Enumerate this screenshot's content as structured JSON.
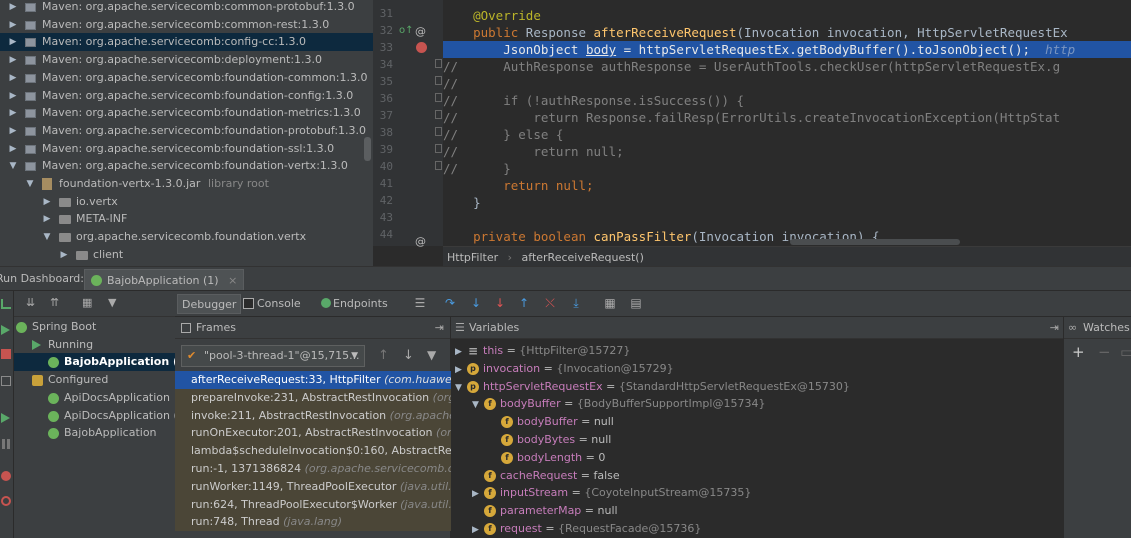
{
  "project_tree": {
    "items": [
      {
        "label": "Maven: org.apache.servicecomb:common-protobuf:1.3.0",
        "depth": 0,
        "expanded": false,
        "selected": false,
        "kind": "lib"
      },
      {
        "label": "Maven: org.apache.servicecomb:common-rest:1.3.0",
        "depth": 0,
        "expanded": false,
        "selected": false,
        "kind": "lib"
      },
      {
        "label": "Maven: org.apache.servicecomb:config-cc:1.3.0",
        "depth": 0,
        "expanded": false,
        "selected": true,
        "kind": "lib"
      },
      {
        "label": "Maven: org.apache.servicecomb:deployment:1.3.0",
        "depth": 0,
        "expanded": false,
        "selected": false,
        "kind": "lib"
      },
      {
        "label": "Maven: org.apache.servicecomb:foundation-common:1.3.0",
        "depth": 0,
        "expanded": false,
        "selected": false,
        "kind": "lib"
      },
      {
        "label": "Maven: org.apache.servicecomb:foundation-config:1.3.0",
        "depth": 0,
        "expanded": false,
        "selected": false,
        "kind": "lib"
      },
      {
        "label": "Maven: org.apache.servicecomb:foundation-metrics:1.3.0",
        "depth": 0,
        "expanded": false,
        "selected": false,
        "kind": "lib"
      },
      {
        "label": "Maven: org.apache.servicecomb:foundation-protobuf:1.3.0",
        "depth": 0,
        "expanded": false,
        "selected": false,
        "kind": "lib"
      },
      {
        "label": "Maven: org.apache.servicecomb:foundation-ssl:1.3.0",
        "depth": 0,
        "expanded": false,
        "selected": false,
        "kind": "lib"
      },
      {
        "label": "Maven: org.apache.servicecomb:foundation-vertx:1.3.0",
        "depth": 0,
        "expanded": true,
        "selected": false,
        "kind": "lib"
      },
      {
        "label": "foundation-vertx-1.3.0.jar",
        "suffix": "library root",
        "depth": 1,
        "expanded": true,
        "selected": false,
        "kind": "jar"
      },
      {
        "label": "io.vertx",
        "depth": 2,
        "expanded": false,
        "selected": false,
        "kind": "pkg"
      },
      {
        "label": "META-INF",
        "depth": 2,
        "expanded": false,
        "selected": false,
        "kind": "pkg"
      },
      {
        "label": "org.apache.servicecomb.foundation.vertx",
        "depth": 2,
        "expanded": true,
        "selected": false,
        "kind": "pkg"
      },
      {
        "label": "client",
        "depth": 3,
        "expanded": false,
        "selected": false,
        "kind": "pkg"
      }
    ]
  },
  "editor": {
    "lines": [
      {
        "n": "31",
        "hl": false,
        "segs": [
          [
            "    ",
            ""
          ],
          [
            "@Override",
            "an"
          ]
        ]
      },
      {
        "n": "32",
        "hl": false,
        "segs": [
          [
            "    ",
            ""
          ],
          [
            "public ",
            "kw"
          ],
          [
            "Response ",
            ""
          ],
          [
            "afterReceiveRequest",
            "fn"
          ],
          [
            "(Invocation invocation, HttpServletRequestEx",
            ""
          ]
        ]
      },
      {
        "n": "33",
        "hl": true,
        "segs": [
          [
            "        JsonObject ",
            ""
          ],
          [
            "body",
            "ul"
          ],
          [
            " = httpServletRequestEx.getBodyBuffer().toJsonObject();  ",
            ""
          ],
          [
            "http",
            "it"
          ]
        ]
      },
      {
        "n": "34",
        "hl": false,
        "segs": [
          [
            "//",
            "cm"
          ],
          [
            "      AuthResponse authResponse = UserAuthTools.checkUser(httpServletRequestEx.g",
            "cm"
          ]
        ]
      },
      {
        "n": "35",
        "hl": false,
        "segs": [
          [
            "//",
            "cm"
          ]
        ]
      },
      {
        "n": "36",
        "hl": false,
        "segs": [
          [
            "//",
            "cm"
          ],
          [
            "      if (!authResponse.isSuccess()) {",
            "cm"
          ]
        ]
      },
      {
        "n": "37",
        "hl": false,
        "segs": [
          [
            "//",
            "cm"
          ],
          [
            "          return Response.failResp(ErrorUtils.createInvocationException(HttpStat",
            "cm"
          ]
        ]
      },
      {
        "n": "38",
        "hl": false,
        "segs": [
          [
            "//",
            "cm"
          ],
          [
            "      } else {",
            "cm"
          ]
        ]
      },
      {
        "n": "39",
        "hl": false,
        "segs": [
          [
            "//",
            "cm"
          ],
          [
            "          return null;",
            "cm"
          ]
        ]
      },
      {
        "n": "40",
        "hl": false,
        "segs": [
          [
            "//",
            "cm"
          ],
          [
            "      }",
            "cm"
          ]
        ]
      },
      {
        "n": "41",
        "hl": false,
        "segs": [
          [
            "        ",
            ""
          ],
          [
            "return null",
            "kw"
          ],
          [
            ";",
            "kw"
          ]
        ]
      },
      {
        "n": "42",
        "hl": false,
        "segs": [
          [
            "    }",
            ""
          ]
        ]
      },
      {
        "n": "43",
        "hl": false,
        "segs": [
          [
            "",
            ""
          ]
        ]
      },
      {
        "n": "44",
        "hl": false,
        "segs": [
          [
            "    ",
            ""
          ],
          [
            "private boolean ",
            "kw"
          ],
          [
            "canPassFilter",
            "fn"
          ],
          [
            "(Invocation invocation) {",
            ""
          ]
        ]
      }
    ]
  },
  "breadcrumb": {
    "class_name": "HttpFilter",
    "separator": "›",
    "method_name": "afterReceiveRequest()"
  },
  "run_dashboard": {
    "title": "Run Dashboard:",
    "tab_label": "BajobApplication (1)",
    "close": "×"
  },
  "run_tree": {
    "items": [
      {
        "label": "Spring Boot",
        "depth": 0,
        "selected": false
      },
      {
        "label": "Running",
        "depth": 1,
        "selected": false
      },
      {
        "label": "BajobApplication (1)",
        "depth": 2,
        "selected": true
      },
      {
        "label": "Configured",
        "depth": 1,
        "selected": false
      },
      {
        "label": "ApiDocsApplication",
        "depth": 2,
        "selected": false
      },
      {
        "label": "ApiDocsApplication (",
        "depth": 2,
        "selected": false
      },
      {
        "label": "BajobApplication",
        "depth": 2,
        "selected": false
      }
    ]
  },
  "debugger_tabs": {
    "debugger": "Debugger",
    "console": "Console",
    "endpoints": "Endpoints"
  },
  "frames": {
    "title": "Frames",
    "thread": "\"pool-3-thread-1\"@15,715...",
    "items": [
      {
        "method": "afterReceiveRequest:33, HttpFilter",
        "loc": "(com.huawei.cloud",
        "selected": true
      },
      {
        "method": "prepareInvoke:231, AbstractRestInvocation",
        "loc": "(org.apa",
        "selected": false
      },
      {
        "method": "invoke:211, AbstractRestInvocation",
        "loc": "(org.apache.serv",
        "selected": false
      },
      {
        "method": "runOnExecutor:201, AbstractRestInvocation",
        "loc": "(org.apa",
        "selected": false
      },
      {
        "method": "lambda$scheduleInvocation$0:160, AbstractRestInvoca",
        "loc": "",
        "selected": false
      },
      {
        "method": "run:-1, 1371386824",
        "loc": "(org.apache.servicecomb.commo",
        "selected": false
      },
      {
        "method": "runWorker:1149, ThreadPoolExecutor",
        "loc": "(java.util.conc",
        "selected": false
      },
      {
        "method": "run:624, ThreadPoolExecutor$Worker",
        "loc": "(java.util.conc",
        "selected": false
      },
      {
        "method": "run:748, Thread",
        "loc": "(java.lang)",
        "selected": false
      }
    ]
  },
  "variables": {
    "title": "Variables",
    "items": [
      {
        "depth": 0,
        "toggle": "▶",
        "icon": "this",
        "name": "this",
        "value": "{HttpFilter@15727}",
        "is_ref": true
      },
      {
        "depth": 0,
        "toggle": "▶",
        "icon": "p",
        "name": "invocation",
        "value": "{Invocation@15729}",
        "is_ref": true
      },
      {
        "depth": 0,
        "toggle": "▼",
        "icon": "p",
        "name": "httpServletRequestEx",
        "value": "{StandardHttpServletRequestEx@15730}",
        "is_ref": true
      },
      {
        "depth": 1,
        "toggle": "▼",
        "icon": "f",
        "name": "bodyBuffer",
        "value": "{BodyBufferSupportImpl@15734}",
        "is_ref": true
      },
      {
        "depth": 2,
        "toggle": "",
        "icon": "f",
        "name": "bodyBuffer",
        "value": "null",
        "is_ref": false
      },
      {
        "depth": 2,
        "toggle": "",
        "icon": "f",
        "name": "bodyBytes",
        "value": "null",
        "is_ref": false
      },
      {
        "depth": 2,
        "toggle": "",
        "icon": "f",
        "name": "bodyLength",
        "value": "0",
        "is_ref": false
      },
      {
        "depth": 1,
        "toggle": "",
        "icon": "f",
        "name": "cacheRequest",
        "value": "false",
        "is_ref": false
      },
      {
        "depth": 1,
        "toggle": "▶",
        "icon": "f",
        "name": "inputStream",
        "value": "{CoyoteInputStream@15735}",
        "is_ref": true
      },
      {
        "depth": 1,
        "toggle": "",
        "icon": "f",
        "name": "parameterMap",
        "value": "null",
        "is_ref": false
      },
      {
        "depth": 1,
        "toggle": "▶",
        "icon": "f",
        "name": "request",
        "value": "{RequestFacade@15736}",
        "is_ref": true
      }
    ]
  },
  "watches": {
    "title": "Watches",
    "add": "+",
    "remove": "−"
  },
  "colors": {
    "selection_blue": "#2154a4",
    "frame_highlight": "#4b4637",
    "panel_bg": "#3c3f41",
    "editor_bg": "#2b2b2b"
  }
}
